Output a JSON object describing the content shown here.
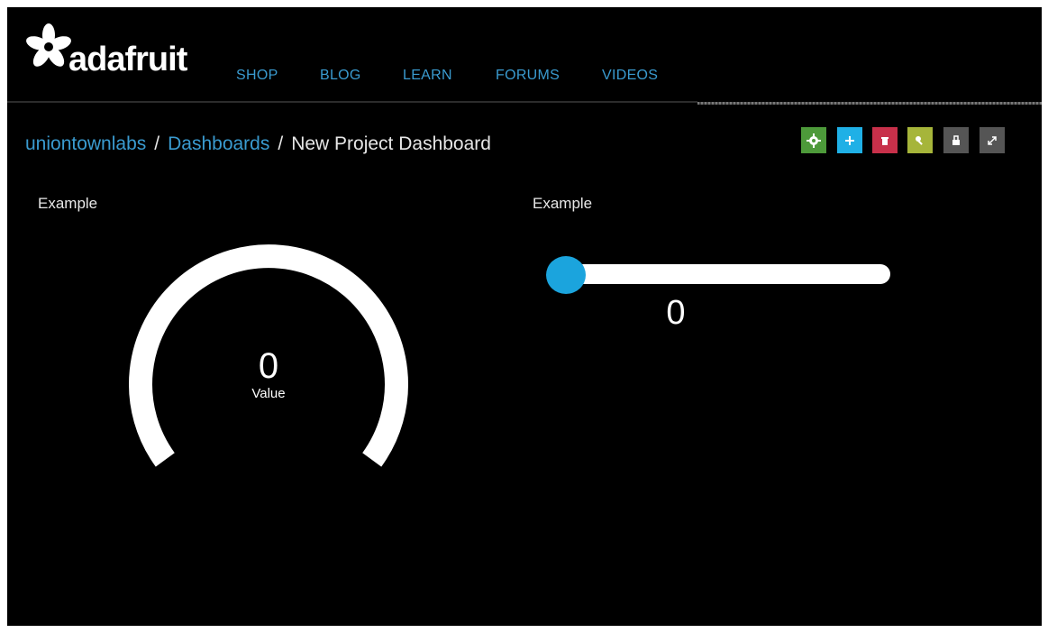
{
  "header": {
    "brand": "adafruit",
    "nav": [
      {
        "label": "SHOP"
      },
      {
        "label": "BLOG"
      },
      {
        "label": "LEARN"
      },
      {
        "label": "FORUMS"
      },
      {
        "label": "VIDEOS"
      }
    ]
  },
  "breadcrumb": {
    "user": "uniontownlabs",
    "section": "Dashboards",
    "current": "New Project Dashboard",
    "separator": "/"
  },
  "toolbar": {
    "buttons": [
      {
        "icon": "gear-icon",
        "color": "#4d9a3a"
      },
      {
        "icon": "plus-icon",
        "color": "#1fb0e6"
      },
      {
        "icon": "trash-icon",
        "color": "#c8304a"
      },
      {
        "icon": "key-icon",
        "color": "#a6b53a"
      },
      {
        "icon": "lock-icon",
        "color": "#555555"
      },
      {
        "icon": "expand-icon",
        "color": "#555555"
      }
    ]
  },
  "widgets": {
    "gauge": {
      "title": "Example",
      "value": "0",
      "label": "Value"
    },
    "slider": {
      "title": "Example",
      "value": "0",
      "position": 0
    }
  },
  "colors": {
    "background": "#000000",
    "link": "#3a9bd0",
    "slider_thumb": "#1ba4dd",
    "text": "#e6e6e6"
  }
}
